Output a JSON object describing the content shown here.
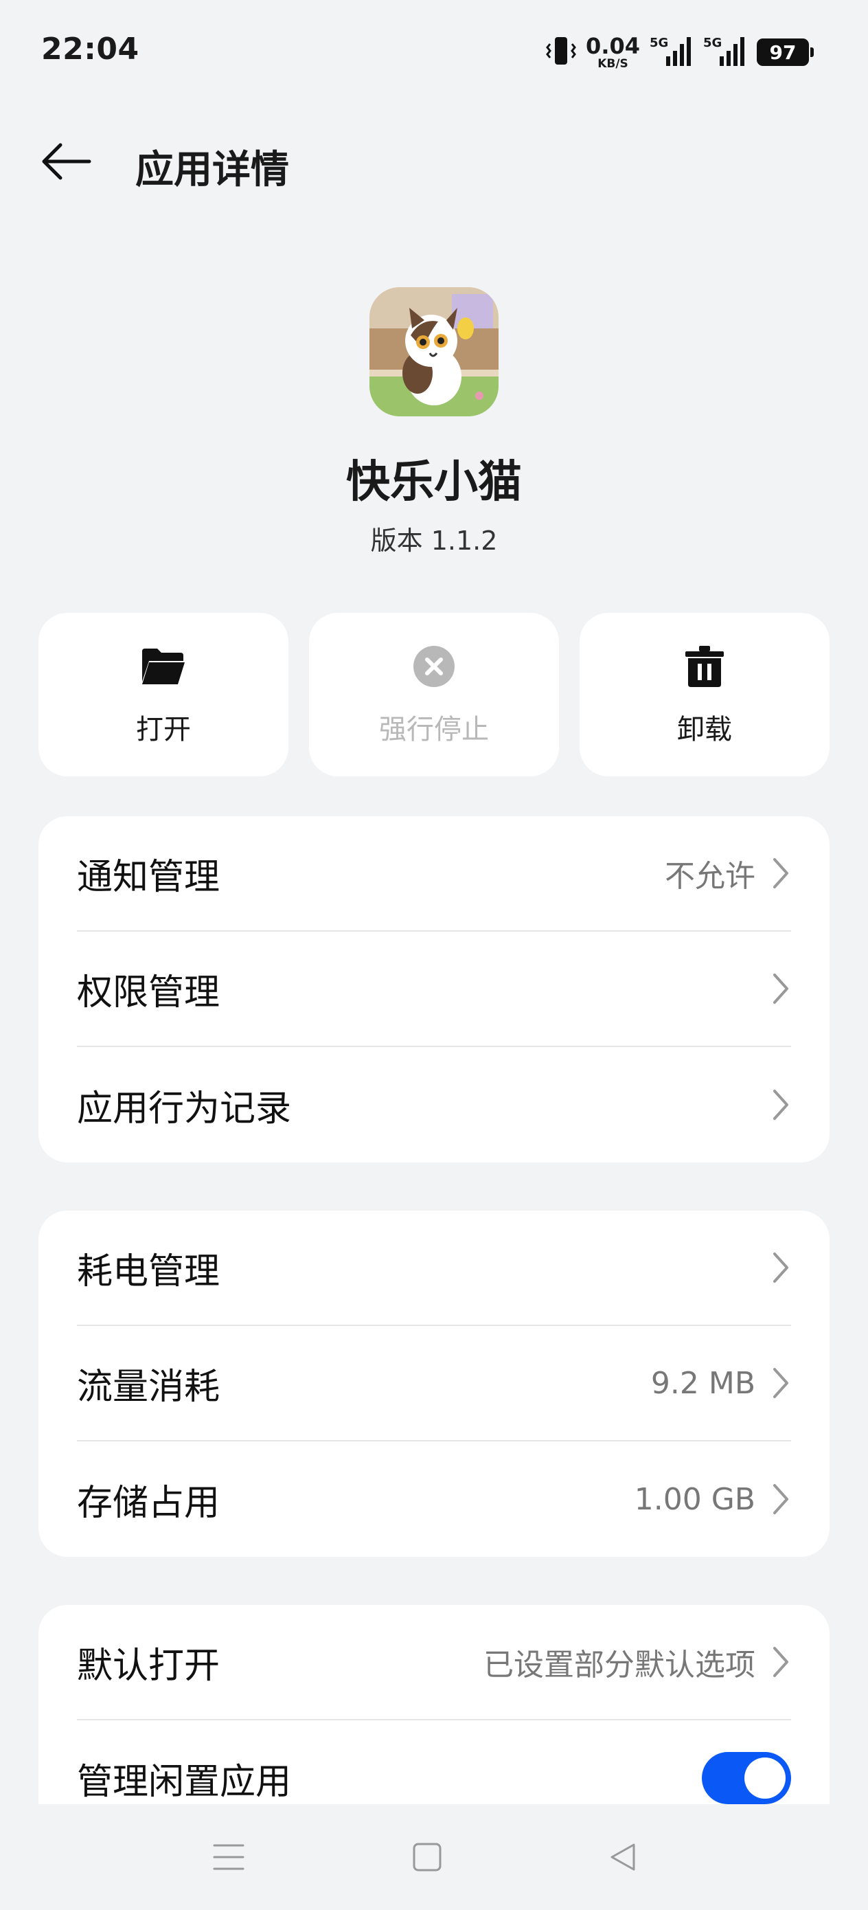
{
  "status_bar": {
    "time": "22:04",
    "net_speed": "0.04",
    "net_unit": "KB/S",
    "signal1_label": "5G",
    "signal2_label": "5G",
    "battery": "97",
    "icons": [
      "vibrate-icon",
      "signal-5g-icon",
      "battery-icon"
    ]
  },
  "header": {
    "title": "应用详情"
  },
  "app": {
    "name": "快乐小猫",
    "version": "版本 1.1.2"
  },
  "actions": {
    "open_label": "打开",
    "force_stop_label": "强行停止",
    "uninstall_label": "卸载"
  },
  "group1": {
    "notification": {
      "title": "通知管理",
      "value": "不允许"
    },
    "permission": {
      "title": "权限管理"
    },
    "behavior": {
      "title": "应用行为记录"
    }
  },
  "group2": {
    "battery": {
      "title": "耗电管理"
    },
    "data": {
      "title": "流量消耗",
      "value": "9.2 MB"
    },
    "storage": {
      "title": "存储占用",
      "value": "1.00 GB"
    }
  },
  "group3": {
    "default_open": {
      "title": "默认打开",
      "value": "已设置部分默认选项"
    },
    "idle": {
      "title": "管理闲置应用",
      "toggle_on": true
    }
  },
  "colors": {
    "accent": "#0a59f7",
    "background": "#f1f3f5",
    "card": "#ffffff"
  }
}
